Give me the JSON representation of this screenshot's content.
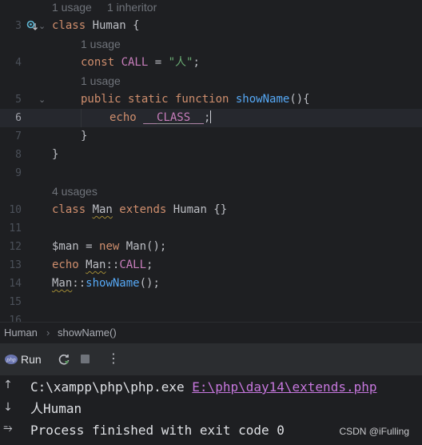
{
  "editor": {
    "hints": {
      "class_usage": "1 usage",
      "inheritors": "1 inheritor",
      "const_usage": "1 usage",
      "fn_usage": "1 usage",
      "man_usages": "4 usages"
    },
    "line_numbers": [
      "3",
      "4",
      "5",
      "6",
      "7",
      "8",
      "9",
      "10",
      "11",
      "12",
      "13",
      "14",
      "15",
      "16"
    ],
    "code": {
      "l3_kw": "class ",
      "l3_name": "Human",
      "l3_rest": " {",
      "l4_kw": "const ",
      "l4_name": "CALL",
      "l4_eq": " = ",
      "l4_str": "\"人\"",
      "l4_end": ";",
      "l5_kw": "public static function ",
      "l5_fn": "showName",
      "l5_end": "(){",
      "l6_kw": "echo ",
      "l6_magic": "__CLASS__",
      "l6_end": ";",
      "l7": "}",
      "l8": "}",
      "l10_kw1": "class ",
      "l10_name": "Man",
      "l10_kw2": " extends ",
      "l10_rest": "Human {}",
      "l12_var": "$man",
      "l12_eq": " = ",
      "l12_kw": "new ",
      "l12_rest": "Man();",
      "l13_kw": "echo ",
      "l13_cls": "Man",
      "l13_sep": "::",
      "l13_const": "CALL",
      "l13_end": ";",
      "l14_cls": "Man",
      "l14_sep": "::",
      "l14_fn": "showName",
      "l14_end": "();"
    }
  },
  "breadcrumb": {
    "item1": "Human",
    "item2": "showName()"
  },
  "run_panel": {
    "tab_label": "Run"
  },
  "console": {
    "cmd": "C:\\xampp\\php\\php.exe ",
    "file_link": "E:\\php\\day14\\extends.php",
    "output": "人Human",
    "exit": "Process finished with exit code 0"
  },
  "watermark": "CSDN @iFulling",
  "colors": {
    "accent": "#3574f0",
    "keyword": "#cf8e6d",
    "function": "#56a8f5",
    "constant": "#c77dbb",
    "string": "#6aab73"
  }
}
